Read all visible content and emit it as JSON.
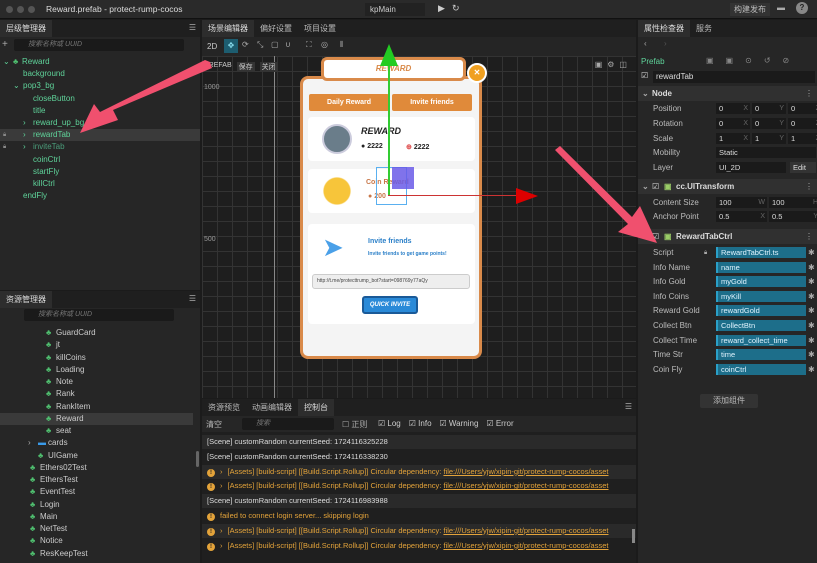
{
  "window": {
    "title": "Reward.prefab - protect-rump-cocos",
    "scene_select": "kpMain",
    "build_label": "构建发布"
  },
  "hierarchy": {
    "tab": "层级管理器",
    "search_placeholder": "搜索名称或 UUID",
    "items": [
      {
        "label": "Reward",
        "depth": 0,
        "arrow": "v",
        "prefab": true
      },
      {
        "label": "background",
        "depth": 1
      },
      {
        "label": "pop3_bg",
        "depth": 1,
        "arrow": "v"
      },
      {
        "label": "closeButton",
        "depth": 2
      },
      {
        "label": "title",
        "depth": 2
      },
      {
        "label": "reward_up_bg",
        "depth": 2,
        "arrow": ">"
      },
      {
        "label": "rewardTab",
        "depth": 2,
        "arrow": ">",
        "selected": true,
        "locked": true
      },
      {
        "label": "inviteTab",
        "depth": 2,
        "arrow": ">",
        "locked": true,
        "dim": true
      },
      {
        "label": "coinCtrl",
        "depth": 2
      },
      {
        "label": "startFly",
        "depth": 2
      },
      {
        "label": "killCtrl",
        "depth": 2
      },
      {
        "label": "endFly",
        "depth": 1
      }
    ]
  },
  "assets": {
    "tab": "资源管理器",
    "search_placeholder": "搜索名称或 UUID",
    "items": [
      {
        "label": "GuardCard",
        "depth": 3
      },
      {
        "label": "jt",
        "depth": 3
      },
      {
        "label": "killCoins",
        "depth": 3
      },
      {
        "label": "Loading",
        "depth": 3
      },
      {
        "label": "Note",
        "depth": 3
      },
      {
        "label": "Rank",
        "depth": 3
      },
      {
        "label": "RankItem",
        "depth": 3
      },
      {
        "label": "Reward",
        "depth": 3,
        "selected": true
      },
      {
        "label": "seat",
        "depth": 3
      },
      {
        "label": "cards",
        "depth": 2,
        "folder": true
      },
      {
        "label": "UIGame",
        "depth": 2
      },
      {
        "label": "Ethers02Test",
        "depth": 1
      },
      {
        "label": "EthersTest",
        "depth": 1
      },
      {
        "label": "EventTest",
        "depth": 1
      },
      {
        "label": "Login",
        "depth": 1
      },
      {
        "label": "Main",
        "depth": 1
      },
      {
        "label": "NetTest",
        "depth": 1
      },
      {
        "label": "Notice",
        "depth": 1
      },
      {
        "label": "ResKeepTest",
        "depth": 1
      }
    ]
  },
  "scene": {
    "tabs": [
      "场景编辑器",
      "偏好设置",
      "项目设置"
    ],
    "mode_2d": "2D",
    "prefab_label": "PREFAB",
    "save": "保存",
    "close": "关闭",
    "ruler": [
      "1000",
      "500"
    ],
    "popup": {
      "title": "REWARD",
      "tab_daily": "Daily Reward",
      "tab_invite": "Invite friends",
      "reward_heading": "REWARD",
      "gold": "2222",
      "kills": "2222",
      "coin_reward": "Coin Reward",
      "coin_amount": "200",
      "invite_title": "Invite friends",
      "invite_sub": "Invite friends to get game points!",
      "link": "http://t.me/protecttrump_bot?start=098769y77aQy",
      "quick_invite": "QUICK INVITE"
    }
  },
  "console": {
    "tabs": [
      "资源预览",
      "动画编辑器",
      "控制台"
    ],
    "clear": "清空",
    "search_placeholder": "搜索",
    "regex": "正则",
    "filters": [
      {
        "label": "Log",
        "checked": true
      },
      {
        "label": "Info",
        "checked": true
      },
      {
        "label": "Warning",
        "checked": true
      },
      {
        "label": "Error",
        "checked": true
      }
    ],
    "lines": [
      {
        "text": "[Scene] customRandom currentSeed: 1724116325228",
        "type": "log"
      },
      {
        "text": "[Scene] customRandom currentSeed: 1724116338230",
        "type": "log"
      },
      {
        "text": "[Assets] [build-script] [[Build.Script.Rollup]] Circular dependency: ",
        "link": "file:///Users/yjw/xipin-git/protect-rump-cocos/asset",
        "type": "warn"
      },
      {
        "text": "[Assets] [build-script] [[Build.Script.Rollup]] Circular dependency: ",
        "link": "file:///Users/yjw/xipin-git/protect-rump-cocos/asset",
        "type": "warn"
      },
      {
        "text": "[Scene] customRandom currentSeed: 1724116983988",
        "type": "log"
      },
      {
        "text": "failed to connect login server... skipping login",
        "type": "warn"
      },
      {
        "text": "[Assets] [build-script] [[Build.Script.Rollup]] Circular dependency: ",
        "link": "file:///Users/yjw/xipin-git/protect-rump-cocos/asset",
        "type": "warn"
      },
      {
        "text": "[Assets] [build-script] [[Build.Script.Rollup]] Circular dependency: ",
        "link": "file:///Users/yjw/xipin-git/protect-rump-cocos/asset",
        "type": "warn"
      }
    ]
  },
  "inspector": {
    "tabs": [
      "属性检查器",
      "服务"
    ],
    "prefab": "Prefab",
    "node_name": "rewardTab",
    "node": {
      "title": "Node",
      "position": [
        "0",
        "0",
        "0"
      ],
      "rotation": [
        "0",
        "0",
        "0"
      ],
      "scale": [
        "1",
        "1",
        "1"
      ],
      "mobility": "Static",
      "layer": "UI_2D",
      "edit": "Edit",
      "labels": {
        "position": "Position",
        "rotation": "Rotation",
        "scale": "Scale",
        "mobility": "Mobility",
        "layer": "Layer"
      }
    },
    "uitransform": {
      "title": "cc.UITransform",
      "content_size_label": "Content Size",
      "content_size": [
        "100",
        "100"
      ],
      "anchor_label": "Anchor Point",
      "anchor": [
        "0.5",
        "0.5"
      ]
    },
    "component": {
      "title": "RewardTabCtrl",
      "props": [
        {
          "label": "Script",
          "value": "RewardTabCtrl.ts"
        },
        {
          "label": "Info Name",
          "value": "name"
        },
        {
          "label": "Info Gold",
          "value": "myGold"
        },
        {
          "label": "Info Coins",
          "value": "myKill"
        },
        {
          "label": "Reward Gold",
          "value": "rewardGold"
        },
        {
          "label": "Collect Btn",
          "value": "CollectBtn"
        },
        {
          "label": "Collect Time",
          "value": "reward_collect_time"
        },
        {
          "label": "Time Str",
          "value": "time"
        },
        {
          "label": "Coin Fly",
          "value": "coinCtrl"
        }
      ]
    },
    "add_component": "添加组件"
  },
  "colors": {
    "accent": "#2aa0c8",
    "tree_text": "#5fd39a",
    "warning": "#e3a33a",
    "annotation_arrow": "#f0506e",
    "popup_orange": "#e08a3a"
  }
}
